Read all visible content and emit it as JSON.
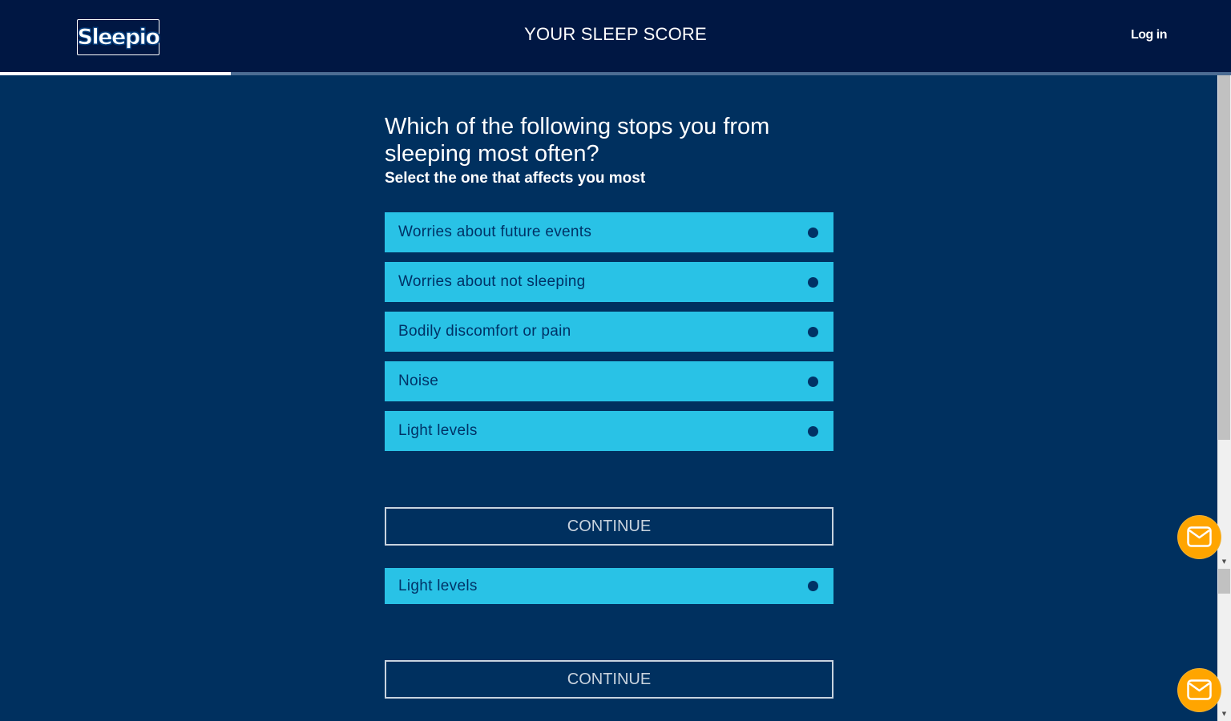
{
  "header": {
    "logo_text": "Sleepio",
    "title": "YOUR SLEEP SCORE",
    "login_label": "Log in",
    "progress": 0.1875
  },
  "question": {
    "title": "Which of the following stops you from sleeping most often?",
    "subtitle": "Select the one that affects you most"
  },
  "options": [
    {
      "label": "Worries about future events"
    },
    {
      "label": "Worries about not sleeping"
    },
    {
      "label": "Bodily discomfort or pain"
    },
    {
      "label": "Noise"
    },
    {
      "label": "Light levels"
    }
  ],
  "continue_label": "CONTINUE",
  "duplicate_option": {
    "label": "Light levels"
  },
  "continue_label_2": "CONTINUE",
  "colors": {
    "header_bg": "#001743",
    "page_bg": "#00305f",
    "option_bg": "#29c2e6",
    "option_text": "#003266",
    "mail_button": "#ffa500"
  },
  "icons": {
    "mail": "mail-icon"
  }
}
